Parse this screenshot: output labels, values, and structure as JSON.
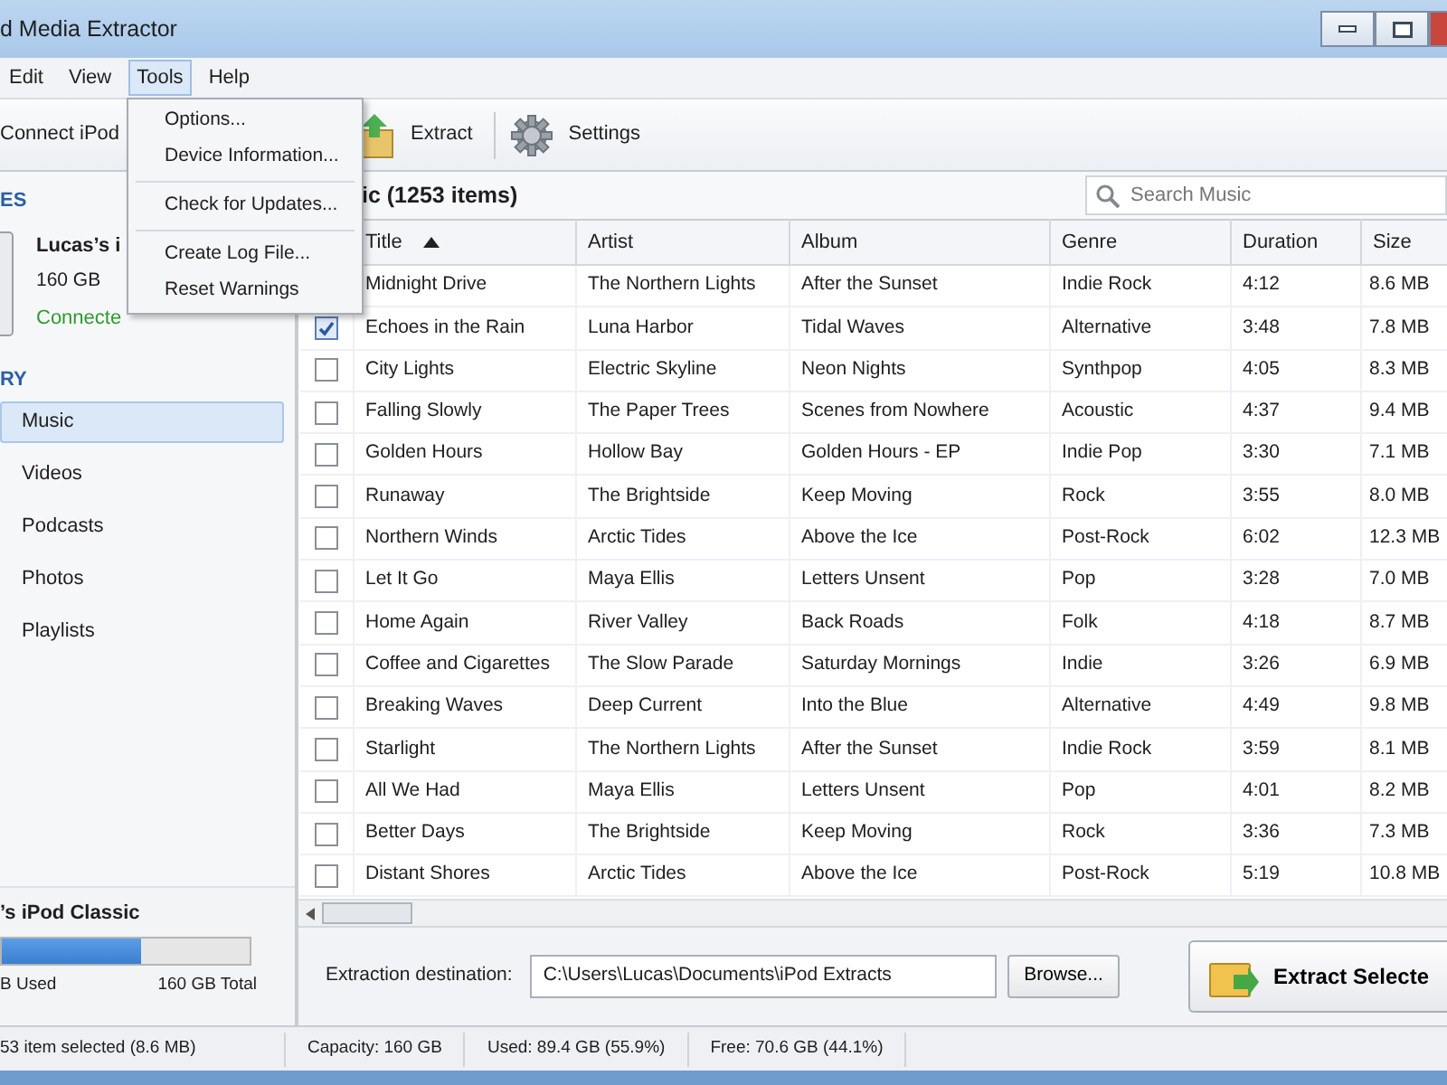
{
  "window": {
    "title": "d Media Extractor"
  },
  "window_controls": [
    {
      "kind": "minimize"
    },
    {
      "kind": "maximize"
    },
    {
      "kind": "close"
    }
  ],
  "menu_bar": [
    {
      "label": "Edit",
      "selected": false
    },
    {
      "label": "View",
      "selected": false
    },
    {
      "label": "Tools",
      "selected": true
    },
    {
      "label": "Help",
      "selected": false
    }
  ],
  "tools_menu": [
    {
      "kind": "item",
      "label": "Options..."
    },
    {
      "kind": "item",
      "label": "Device Information..."
    },
    {
      "kind": "separator"
    },
    {
      "kind": "item",
      "label": "Check for Updates..."
    },
    {
      "kind": "separator"
    },
    {
      "kind": "item",
      "label": "Create Log File..."
    },
    {
      "kind": "item",
      "label": "Reset Warnings"
    }
  ],
  "toolbar": [
    {
      "kind": "text",
      "label": "Connect iPod"
    },
    {
      "kind": "extract",
      "label": "Extract"
    },
    {
      "kind": "separator"
    },
    {
      "kind": "settings",
      "label": "Settings"
    }
  ],
  "sidebar": {
    "devices_header": "ES",
    "device": {
      "name": "Lucas’s i",
      "capacity": "160 GB",
      "status": "Connecte"
    },
    "library_header": "RY",
    "items": [
      {
        "label": "Music",
        "selected": true
      },
      {
        "label": "Videos",
        "selected": false
      },
      {
        "label": "Podcasts",
        "selected": false
      },
      {
        "label": "Photos",
        "selected": false
      },
      {
        "label": "Playlists",
        "selected": false
      }
    ],
    "storage": {
      "title": "’s iPod Classic",
      "level": 0.559,
      "used": "B Used",
      "total": "160 GB Total"
    }
  },
  "content": {
    "heading": "ic (1253 items)",
    "search": {
      "placeholder": "Search Music"
    }
  },
  "table": {
    "columns": [
      {
        "label": "Title",
        "sorted": true
      },
      {
        "label": "Artist",
        "sorted": false
      },
      {
        "label": "Album",
        "sorted": false
      },
      {
        "label": "Genre",
        "sorted": false
      },
      {
        "label": "Duration",
        "sorted": false
      },
      {
        "label": "Size",
        "sorted": false
      }
    ],
    "rows": [
      {
        "cells": [
          "Midnight Drive",
          "The Northern Lights",
          "After the Sunset",
          "Indie Rock",
          "4:12",
          "8.6 MB"
        ]
      },
      {
        "checked": true,
        "cells": [
          "Echoes in the Rain",
          "Luna Harbor",
          "Tidal Waves",
          "Alternative",
          "3:48",
          "7.8 MB"
        ]
      },
      {
        "checked": false,
        "cells": [
          "City Lights",
          "Electric Skyline",
          "Neon Nights",
          "Synthpop",
          "4:05",
          "8.3 MB"
        ]
      },
      {
        "checked": false,
        "cells": [
          "Falling Slowly",
          "The Paper Trees",
          "Scenes from Nowhere",
          "Acoustic",
          "4:37",
          "9.4 MB"
        ]
      },
      {
        "checked": false,
        "cells": [
          "Golden Hours",
          "Hollow Bay",
          "Golden Hours - EP",
          "Indie Pop",
          "3:30",
          "7.1 MB"
        ]
      },
      {
        "checked": false,
        "cells": [
          "Runaway",
          "The Brightside",
          "Keep Moving",
          "Rock",
          "3:55",
          "8.0 MB"
        ]
      },
      {
        "checked": false,
        "cells": [
          "Northern Winds",
          "Arctic Tides",
          "Above the Ice",
          "Post-Rock",
          "6:02",
          "12.3 MB"
        ]
      },
      {
        "checked": false,
        "cells": [
          "Let It Go",
          "Maya Ellis",
          "Letters Unsent",
          "Pop",
          "3:28",
          "7.0 MB"
        ]
      },
      {
        "checked": false,
        "cells": [
          "Home Again",
          "River Valley",
          "Back Roads",
          "Folk",
          "4:18",
          "8.7 MB"
        ]
      },
      {
        "checked": false,
        "cells": [
          "Coffee and Cigarettes",
          "The Slow Parade",
          "Saturday Mornings",
          "Indie",
          "3:26",
          "6.9 MB"
        ]
      },
      {
        "checked": false,
        "cells": [
          "Breaking Waves",
          "Deep Current",
          "Into the Blue",
          "Alternative",
          "4:49",
          "9.8 MB"
        ]
      },
      {
        "checked": false,
        "cells": [
          "Starlight",
          "The Northern Lights",
          "After the Sunset",
          "Indie Rock",
          "3:59",
          "8.1 MB"
        ]
      },
      {
        "checked": false,
        "cells": [
          "All We Had",
          "Maya Ellis",
          "Letters Unsent",
          "Pop",
          "4:01",
          "8.2 MB"
        ]
      },
      {
        "checked": false,
        "cells": [
          "Better Days",
          "The Brightside",
          "Keep Moving",
          "Rock",
          "3:36",
          "7.3 MB"
        ]
      },
      {
        "checked": false,
        "cells": [
          "Distant Shores",
          "Arctic Tides",
          "Above the Ice",
          "Post-Rock",
          "5:19",
          "10.8 MB"
        ]
      }
    ]
  },
  "destination": {
    "label": "Extraction destination:",
    "value": "C:\\Users\\Lucas\\Documents\\iPod Extracts",
    "browse": "Browse..."
  },
  "extract_button": "Extract Selecte",
  "status_bar": [
    "53 item selected (8.6 MB)",
    "Capacity: 160 GB",
    "Used: 89.4 GB (55.9%)",
    "Free: 70.6 GB (44.1%)"
  ]
}
